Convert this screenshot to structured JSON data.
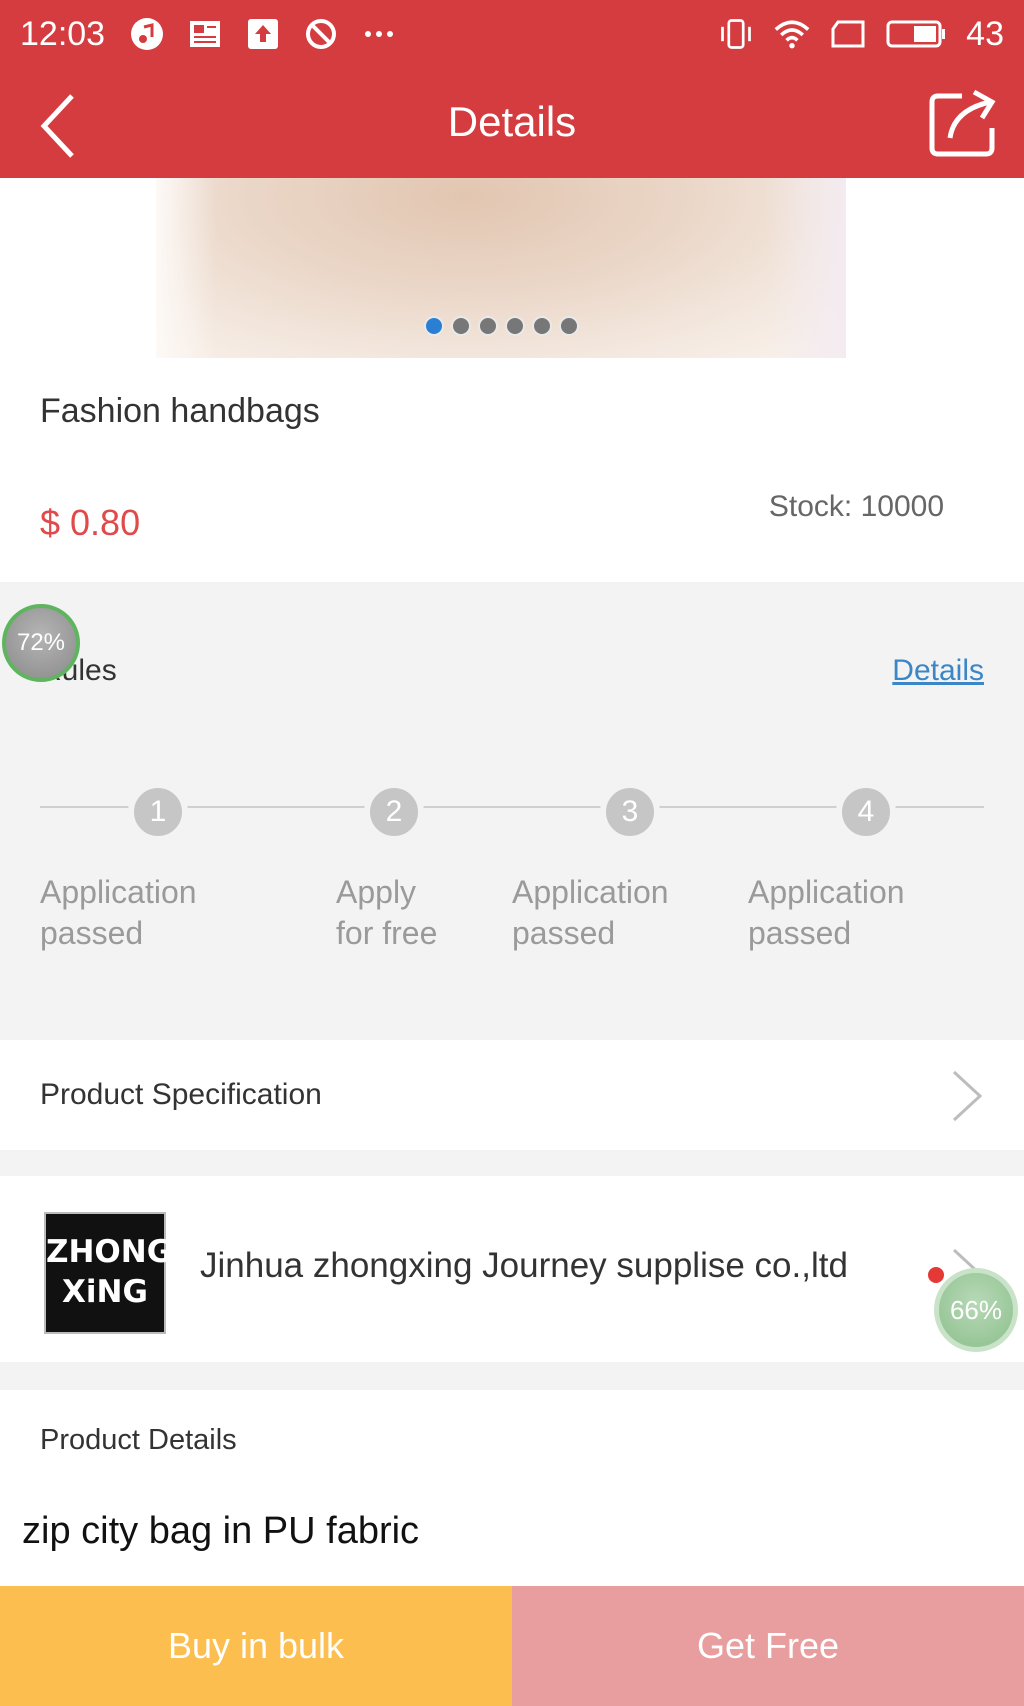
{
  "status_bar": {
    "time": "12:03",
    "battery": "43",
    "left_icons": [
      "music-icon",
      "news-icon",
      "upload-icon",
      "blocked-icon",
      "more-dots-icon"
    ],
    "right_icons": [
      "vibrate-icon",
      "wifi-icon",
      "sim-icon",
      "battery-icon"
    ]
  },
  "header": {
    "title": "Details",
    "back_icon": "chevron-left-icon",
    "share_icon": "share-icon"
  },
  "banner": {
    "dots_count": 6,
    "active_index": 0
  },
  "product": {
    "name": "Fashion handbags",
    "price": "$ 0.80",
    "stock": "Stock: 10000"
  },
  "rules": {
    "title": "Rules",
    "link": "Details",
    "steps": [
      {
        "number": "1",
        "label_line1": "Application",
        "label_line2": "passed"
      },
      {
        "number": "2",
        "label_line1": "Apply",
        "label_line2": "for free"
      },
      {
        "number": "3",
        "label_line1": "Application",
        "label_line2": "passed"
      },
      {
        "number": "4",
        "label_line1": "Application",
        "label_line2": "passed"
      }
    ]
  },
  "overlays": {
    "badge_left": "72%",
    "badge_right": "66%"
  },
  "specification": {
    "label": "Product Specification"
  },
  "supplier": {
    "logo_line1": "ZHONG",
    "logo_line2": "XiNG",
    "name": "Jinhua zhongxing Journey supplise co.,ltd"
  },
  "details": {
    "heading": "Product Details",
    "text": "zip city bag in PU fabric"
  },
  "actions": {
    "bulk": "Buy in bulk",
    "free": "Get Free"
  },
  "colors": {
    "brand_red": "#d43c3f",
    "price_red": "#e04a4a",
    "bulk_yellow": "#fcbe4e",
    "free_pink": "#e89d9e",
    "link_blue": "#3b86c6"
  }
}
